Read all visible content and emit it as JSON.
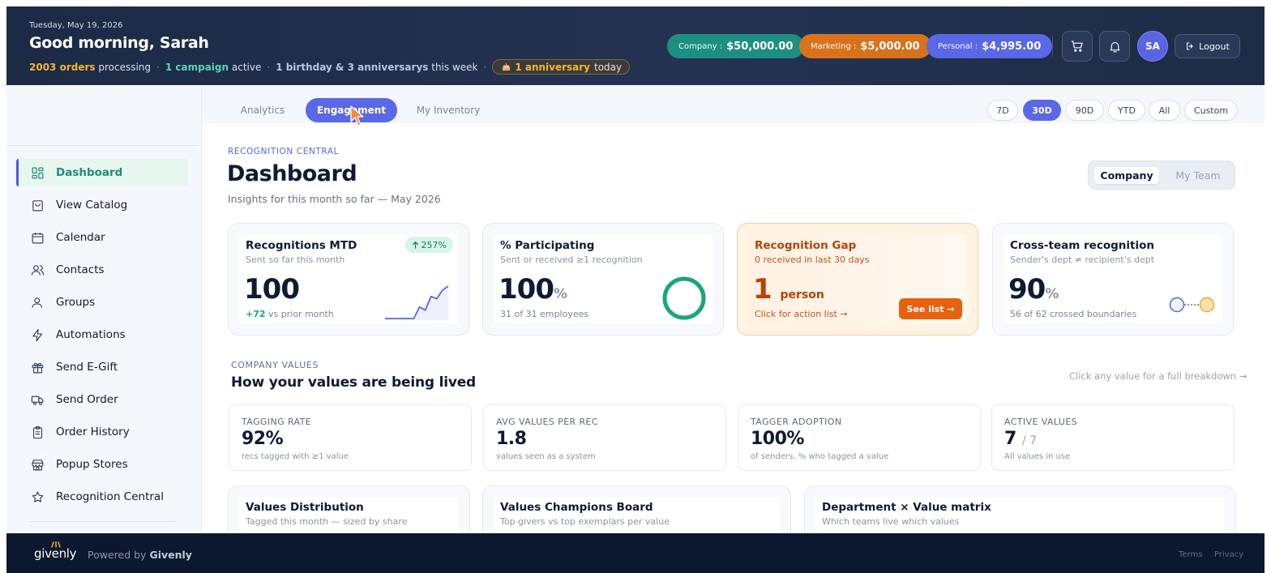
{
  "header": {
    "date": "Tuesday, May 19, 2026",
    "greeting": "Good morning, Sarah",
    "orders_count": "2003 orders",
    "orders_suffix": "processing",
    "campaign_count": "1 campaign",
    "campaign_suffix": "active",
    "celebrations": "1 birthday & 3 anniversarys",
    "celebrations_suffix": "this week",
    "anniv_count": "1 anniversary",
    "anniv_suffix": "today",
    "balances": [
      {
        "label": "Company :",
        "value": "$50,000.00",
        "color": "#1d8f80"
      },
      {
        "label": "Marketing :",
        "value": "$5,000.00",
        "color": "#d9721c"
      },
      {
        "label": "Personal :",
        "value": "$4,995.00",
        "color": "#5a67e6"
      }
    ],
    "avatar_initials": "SA",
    "logout_label": "Logout"
  },
  "sidebar": {
    "items": [
      {
        "label": "Dashboard",
        "icon": "dashboard-grid-icon",
        "active": true
      },
      {
        "label": "View Catalog",
        "icon": "shopping-bag-icon"
      },
      {
        "label": "Calendar",
        "icon": "calendar-icon"
      },
      {
        "label": "Contacts",
        "icon": "contacts-icon"
      },
      {
        "label": "Groups",
        "icon": "user-icon"
      },
      {
        "label": "Automations",
        "icon": "lightning-icon"
      },
      {
        "label": "Send E-Gift",
        "icon": "gift-icon"
      },
      {
        "label": "Send Order",
        "icon": "truck-icon"
      },
      {
        "label": "Order History",
        "icon": "clipboard-icon"
      },
      {
        "label": "Popup Stores",
        "icon": "store-icon"
      },
      {
        "label": "Recognition Central",
        "icon": "star-icon"
      }
    ]
  },
  "tabs": [
    {
      "label": "Analytics",
      "active": false
    },
    {
      "label": "Engagement",
      "active": true
    },
    {
      "label": "My Inventory",
      "active": false
    }
  ],
  "ranges": [
    {
      "label": "7D",
      "active": false
    },
    {
      "label": "30D",
      "active": true
    },
    {
      "label": "90D",
      "active": false
    },
    {
      "label": "YTD",
      "active": false
    },
    {
      "label": "All",
      "active": false
    },
    {
      "label": "Custom",
      "active": false
    }
  ],
  "page": {
    "eyebrow": "RECOGNITION CENTRAL",
    "title": "Dashboard",
    "subtitle": "Insights for this month so far — May 2026",
    "scope_options": [
      "Company",
      "My Team"
    ],
    "scope_selected": "Company"
  },
  "stats": {
    "recognitions": {
      "title": "Recognitions MTD",
      "sub": "Sent so far this month",
      "value": "100",
      "badge": "257%",
      "delta": "+72",
      "delta_suffix": "vs prior month",
      "trend": [
        1,
        1,
        1,
        1,
        1,
        1,
        12,
        9,
        22,
        20,
        28,
        32
      ]
    },
    "participating": {
      "title": "% Participating",
      "sub": "Sent or received ≥1 recognition",
      "value": "100",
      "unit": "%",
      "foot": "31 of 31 employees",
      "ring_fraction": 1.0
    },
    "gap": {
      "title": "Recognition Gap",
      "sub": "0 received in last 30 days",
      "value": "1",
      "unit": "person",
      "foot": "Click for action list →",
      "button": "See list →"
    },
    "cross_team": {
      "title": "Cross-team recognition",
      "sub": "Sender's dept ≠ recipient's dept",
      "value": "90",
      "unit": "%",
      "foot": "56 of 62 crossed boundaries"
    }
  },
  "values_section": {
    "eyebrow": "COMPANY VALUES",
    "title": "How your values are being lived",
    "hint": "Click any value for a full breakdown →",
    "kpis": [
      {
        "label": "TAGGING RATE",
        "value": "92%",
        "unit": "",
        "sub": "recs tagged with ≥1 value"
      },
      {
        "label": "AVG VALUES PER REC",
        "value": "1.8",
        "unit": "",
        "sub": "values seen as a system"
      },
      {
        "label": "TAGGER ADOPTION",
        "value": "100%",
        "unit": "",
        "sub": "of senders, % who tagged a value"
      },
      {
        "label": "ACTIVE VALUES",
        "value": "7",
        "unit": "/ 7",
        "sub": "All values in use"
      }
    ]
  },
  "bottom_cards": [
    {
      "title": "Values Distribution",
      "sub": "Tagged this month — sized by share"
    },
    {
      "title": "Values Champions Board",
      "sub": "Top givers vs top exemplars per value"
    },
    {
      "title": "Department × Value matrix",
      "sub": "Which teams live which values"
    }
  ],
  "footer": {
    "logo": "givenly",
    "powered_prefix": "Powered by",
    "powered_brand": "Givenly",
    "links": [
      "Terms",
      "Privacy"
    ]
  },
  "colors": {
    "accent": "#5a67e6",
    "success": "#1aa67a",
    "warning": "#e8610f",
    "header_bg": "#1b2a45"
  }
}
